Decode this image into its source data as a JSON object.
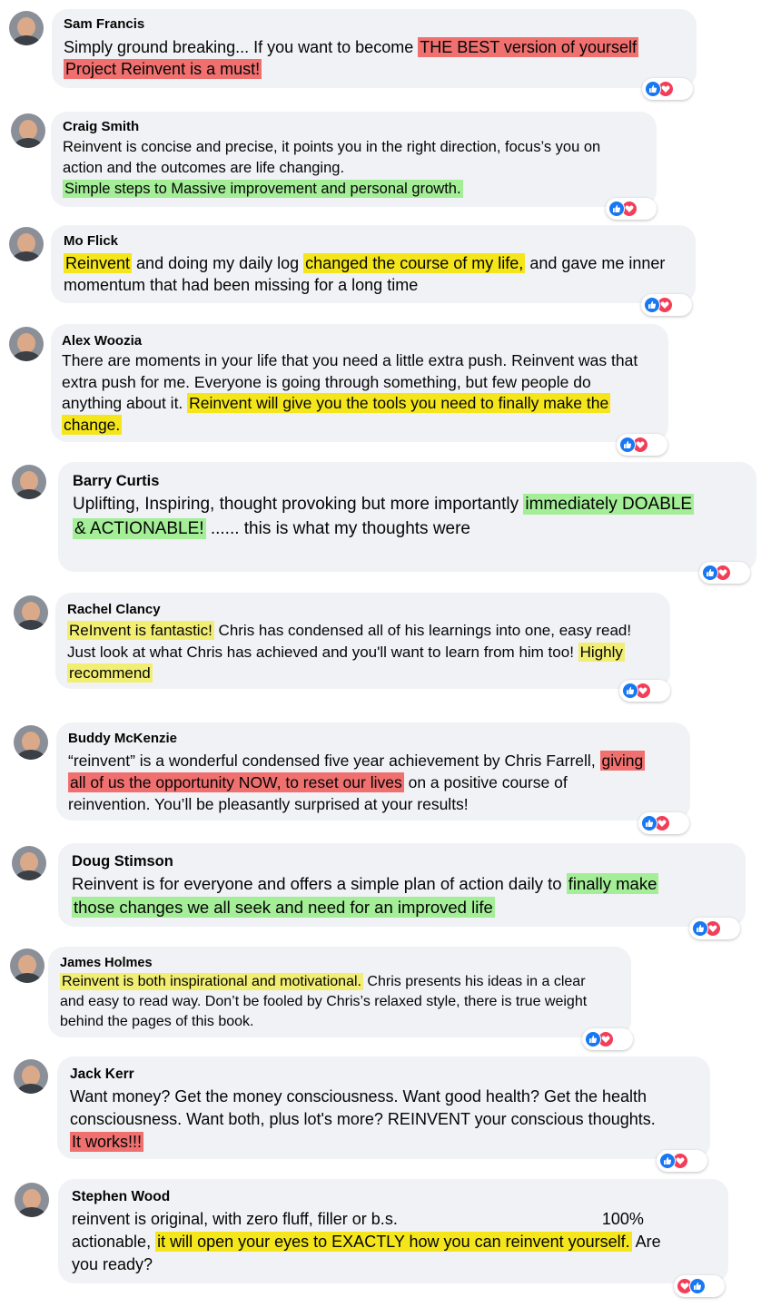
{
  "comments": [
    {
      "name": "Sam Francis",
      "lines": [
        [
          {
            "t": "Simply ground breaking... If you want to become "
          },
          {
            "t": "THE BEST version of yourself",
            "h": "red"
          }
        ],
        [
          {
            "t": "Project Reinvent is a must!",
            "h": "red"
          }
        ]
      ]
    },
    {
      "name": "Craig Smith",
      "lines": [
        [
          {
            "t": "Reinvent is concise and precise, it points you in the right direction, focus’s you on"
          }
        ],
        [
          {
            "t": "action and the outcomes are life changing."
          }
        ],
        [
          {
            "t": "Simple steps to Massive improvement and personal growth.",
            "h": "green"
          }
        ]
      ]
    },
    {
      "name": "Mo Flick",
      "lines": [
        [
          {
            "t": "Reinvent",
            "h": "yellow"
          },
          {
            "t": " and doing my daily log "
          },
          {
            "t": "changed the course of my life,",
            "h": "yellow"
          },
          {
            "t": " and gave me inner"
          }
        ],
        [
          {
            "t": "momentum that had been missing for a long time"
          }
        ]
      ]
    },
    {
      "name": "Alex Woozia",
      "lines": [
        [
          {
            "t": "There are moments in your life that you need a little extra push. Reinvent was that"
          }
        ],
        [
          {
            "t": "extra push for me. Everyone is going through something, but few people do"
          }
        ],
        [
          {
            "t": "anything about it. "
          },
          {
            "t": "Reinvent will give you the tools you need to finally make the",
            "h": "yellow"
          }
        ],
        [
          {
            "t": "change.",
            "h": "yellow"
          }
        ]
      ]
    },
    {
      "name": "Barry Curtis",
      "lines": [
        [
          {
            "t": "Uplifting, Inspiring, thought provoking but more importantly "
          },
          {
            "t": "immediately DOABLE",
            "h": "green"
          }
        ],
        [
          {
            "t": "& ACTIONABLE!",
            "h": "green"
          },
          {
            "t": " ...... this is what my thoughts were"
          }
        ]
      ]
    },
    {
      "name": "Rachel Clancy",
      "lines": [
        [
          {
            "t": "ReInvent is fantastic!",
            "h": "lightyellow"
          },
          {
            "t": " Chris has condensed all of his learnings into one, easy read!"
          }
        ],
        [
          {
            "t": "Just look at what Chris has achieved and you'll want to learn from him too! "
          },
          {
            "t": "Highly",
            "h": "lightyellow"
          }
        ],
        [
          {
            "t": "recommend   ",
            "h": "lightyellow"
          }
        ]
      ]
    },
    {
      "name": "Buddy McKenzie",
      "lines": [
        [
          {
            "t": "“reinvent” is a wonderful condensed five year achievement by Chris Farrell, "
          },
          {
            "t": "giving",
            "h": "red"
          }
        ],
        [
          {
            "t": "all of us the opportunity NOW, to reset our lives",
            "h": "red"
          },
          {
            "t": " on a positive course of"
          }
        ],
        [
          {
            "t": "reinvention. You’ll be pleasantly surprised at your results!"
          }
        ]
      ]
    },
    {
      "name": "Doug Stimson",
      "lines": [
        [
          {
            "t": "Reinvent is for everyone and offers a simple plan of action daily to "
          },
          {
            "t": "finally make",
            "h": "green"
          }
        ],
        [
          {
            "t": "those changes we all seek and need for an improved life",
            "h": "green"
          }
        ]
      ]
    },
    {
      "name": "James Holmes",
      "lines": [
        [
          {
            "t": "Reinvent is both inspirational and motivational.",
            "h": "lightyellow"
          },
          {
            "t": " Chris presents his ideas in a clear"
          }
        ],
        [
          {
            "t": "and easy to read way. Don’t be fooled by Chris’s relaxed style, there is true weight"
          }
        ],
        [
          {
            "t": "behind the pages of this book."
          }
        ]
      ]
    },
    {
      "name": "Jack Kerr",
      "lines": [
        [
          {
            "t": "Want money? Get the money consciousness. Want good health? Get the health"
          }
        ],
        [
          {
            "t": "consciousness. Want both, plus lot's more? REINVENT your conscious thoughts."
          }
        ],
        [
          {
            "t": "It works!!!",
            "h": "red"
          }
        ]
      ]
    },
    {
      "name": "Stephen Wood",
      "lines": [
        [
          {
            "t": "reinvent is original, with zero fluff, filler or b.s."
          },
          {
            "t": "100%",
            "gap": true
          }
        ],
        [
          {
            "t": "actionable, "
          },
          {
            "t": "it will open your eyes to EXACTLY how you can reinvent yourself.",
            "h": "yellow"
          },
          {
            "t": " Are"
          }
        ],
        [
          {
            "t": "you ready?"
          }
        ]
      ]
    }
  ],
  "colors": {
    "red_highlight": "#f07070",
    "green_highlight": "#a3ee97",
    "yellow_highlight": "#f4e61b",
    "light_yellow_highlight": "#f1ee73",
    "like": "#1877f2",
    "love": "#f33e58",
    "bubble": "#f0f2f5"
  },
  "icons": {
    "like": "thumbs-up-icon",
    "love": "heart-icon"
  }
}
